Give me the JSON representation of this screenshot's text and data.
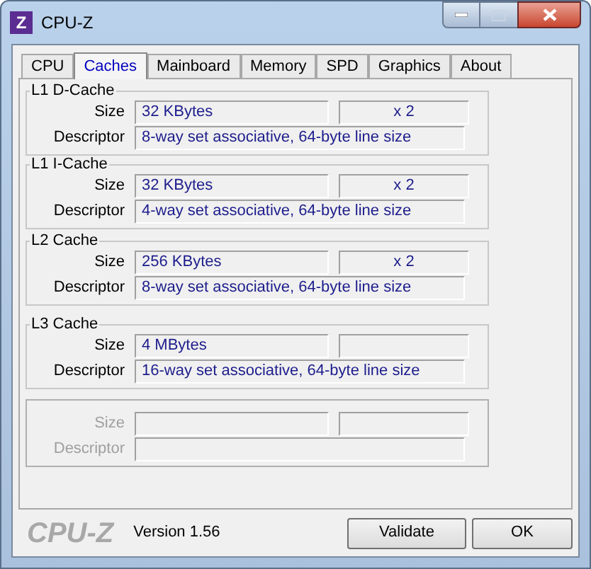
{
  "window": {
    "title": "CPU-Z",
    "icon_letter": "Z"
  },
  "tabs": [
    {
      "label": "CPU",
      "selected": false
    },
    {
      "label": "Caches",
      "selected": true
    },
    {
      "label": "Mainboard",
      "selected": false
    },
    {
      "label": "Memory",
      "selected": false
    },
    {
      "label": "SPD",
      "selected": false
    },
    {
      "label": "Graphics",
      "selected": false
    },
    {
      "label": "About",
      "selected": false
    }
  ],
  "caches": [
    {
      "title": "L1 D-Cache",
      "disabled": false,
      "size_label": "Size",
      "size": "32 KBytes",
      "count": "x 2",
      "descriptor_label": "Descriptor",
      "descriptor": "8-way set associative, 64-byte line size"
    },
    {
      "title": "L1 I-Cache",
      "disabled": false,
      "size_label": "Size",
      "size": "32 KBytes",
      "count": "x 2",
      "descriptor_label": "Descriptor",
      "descriptor": "4-way set associative, 64-byte line size"
    },
    {
      "title": "L2 Cache",
      "disabled": false,
      "size_label": "Size",
      "size": "256 KBytes",
      "count": "x 2",
      "descriptor_label": "Descriptor",
      "descriptor": "8-way set associative, 64-byte line size"
    },
    {
      "title": "L3 Cache",
      "disabled": false,
      "size_label": "Size",
      "size": "4 MBytes",
      "descriptor_label": "Descriptor",
      "descriptor": "16-way set associative, 64-byte line size"
    },
    {
      "disabled": true,
      "size_label": "Size",
      "descriptor_label": "Descriptor"
    }
  ],
  "footer": {
    "logo": "CPU-Z",
    "version": "Version 1.56",
    "buttons": [
      "Validate",
      "OK"
    ]
  }
}
